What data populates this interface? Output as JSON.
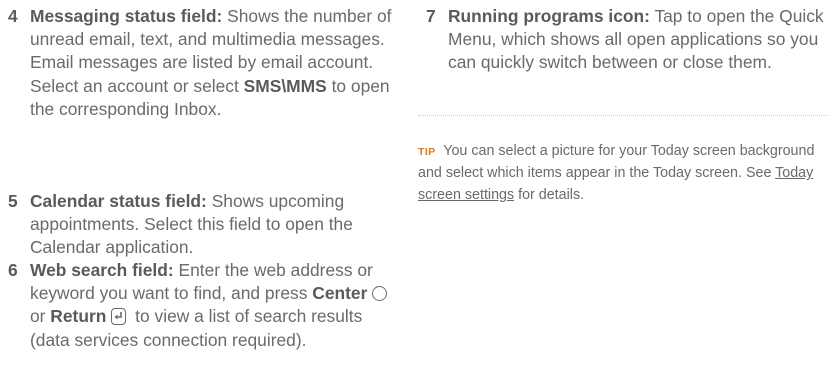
{
  "left_column": {
    "items": [
      {
        "number": "4",
        "term": "Messaging status field:",
        "text_before": " Shows the number of unread email, text, and multimedia messages. Email messages are listed by email account. Select an account or select ",
        "bold_inline": "SMS\\MMS",
        "text_after": " to open the corresponding Inbox."
      },
      {
        "number": "5",
        "term": "Calendar status field:",
        "text": " Shows upcoming appointments. Select this field to open the Calendar application."
      },
      {
        "number": "6",
        "term": "Web search field:",
        "text_before": " Enter the web address or keyword you want to find, and press ",
        "key1": "Center",
        "key1_icon": "center-button-icon",
        "text_mid": " or ",
        "key2": "Return",
        "key2_icon": "return-key-icon",
        "text_after": " to view a list of search results (data services connection required)."
      }
    ]
  },
  "right_column": {
    "item": {
      "number": "7",
      "term": "Running programs icon:",
      "text": " Tap to open the Quick Menu, which shows all open applications so you can quickly switch between or close them."
    },
    "tip": {
      "label": "TIP",
      "text_before": " You can select a picture for your Today screen background and select which items appear in the Today screen. See ",
      "link": "Today screen settings",
      "text_after": " for details."
    }
  },
  "colors": {
    "body_text": "#6a6a6a",
    "tip_label": "#e07a10"
  }
}
